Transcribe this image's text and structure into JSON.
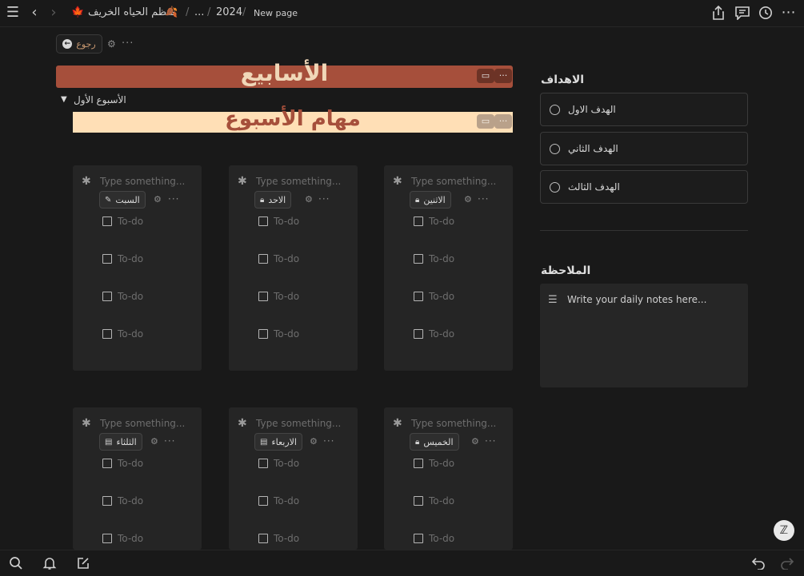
{
  "topbar": {
    "breadcrumb": {
      "page_emoji": "🍁",
      "page_title": "منظم الحياه الخريف",
      "page_icon": "🍂",
      "ellipsis": "...",
      "year": "2024",
      "current": "New page"
    },
    "icons": [
      "menu-icon",
      "back-arrow-icon",
      "forward-arrow-icon",
      "share-icon",
      "comments-icon",
      "history-icon",
      "more-icon"
    ]
  },
  "back_button": {
    "label": "رجوع"
  },
  "weeks": {
    "title": "الأسابيع"
  },
  "toggle": {
    "label": "الأسبوع الأول"
  },
  "tasks": {
    "title": "مهام الأسبوع"
  },
  "day_cards": [
    {
      "placeholder": "Type something...",
      "day": "السبت",
      "icon": "pencil-icon",
      "todos": [
        "To-do",
        "To-do",
        "To-do",
        "To-do"
      ]
    },
    {
      "placeholder": "Type something...",
      "day": "الاحد",
      "icon": "lock-icon",
      "todos": [
        "To-do",
        "To-do",
        "To-do",
        "To-do"
      ]
    },
    {
      "placeholder": "Type something...",
      "day": "الاثنين",
      "icon": "lock-icon",
      "todos": [
        "To-do",
        "To-do",
        "To-do",
        "To-do"
      ]
    },
    {
      "placeholder": "Type something...",
      "day": "الثلثاء",
      "icon": "document-icon",
      "todos": [
        "To-do",
        "To-do",
        "To-do"
      ]
    },
    {
      "placeholder": "Type something...",
      "day": "الاربعاء",
      "icon": "document-icon",
      "todos": [
        "To-do",
        "To-do",
        "To-do"
      ]
    },
    {
      "placeholder": "Type something...",
      "day": "الخميس",
      "icon": "lock-icon",
      "todos": [
        "To-do",
        "To-do",
        "To-do"
      ]
    }
  ],
  "goals": {
    "heading": "الاهداف",
    "items": [
      "الهدف الاول",
      "الهدف الثاني",
      "الهدف الثالث"
    ]
  },
  "notes": {
    "heading": "الملاحظة",
    "placeholder": "Write your daily notes here..."
  },
  "colors": {
    "weeks_banner": "#a64f3b",
    "weeks_title": "#f0d7b8",
    "tasks_banner": "#ffdfb6",
    "tasks_title": "#a64f3b"
  }
}
